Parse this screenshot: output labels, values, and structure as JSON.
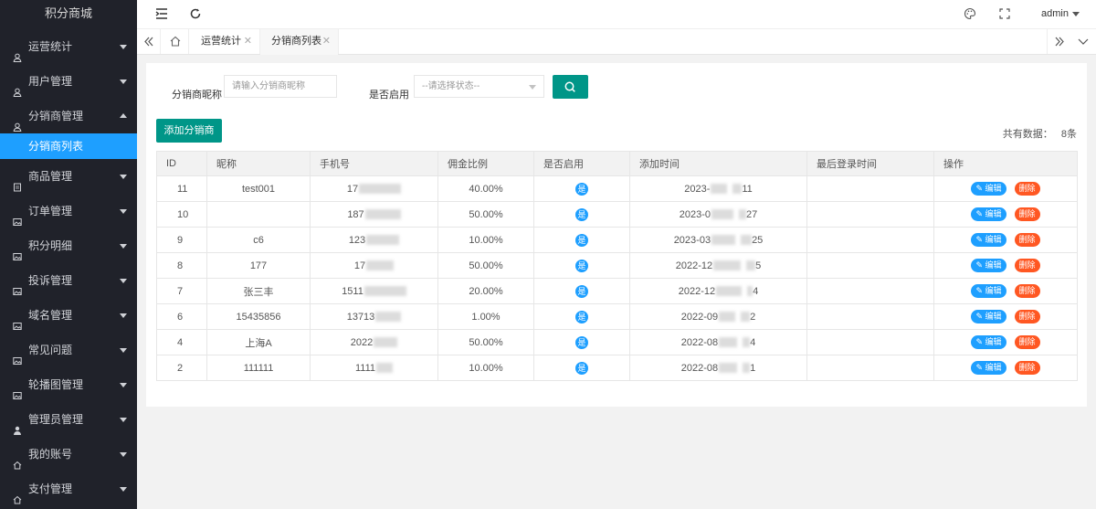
{
  "app": {
    "title": "积分商城"
  },
  "sidebar": {
    "items": [
      {
        "label": "运营统计",
        "icon": "user-icon"
      },
      {
        "label": "用户管理",
        "icon": "user-icon"
      },
      {
        "label": "分销商管理",
        "icon": "user-icon",
        "expanded": true
      },
      {
        "label": "商品管理",
        "icon": "document-icon"
      },
      {
        "label": "订单管理",
        "icon": "image-icon"
      },
      {
        "label": "积分明细",
        "icon": "image-icon"
      },
      {
        "label": "投诉管理",
        "icon": "image-icon"
      },
      {
        "label": "域名管理",
        "icon": "image-icon"
      },
      {
        "label": "常见问题",
        "icon": "image-icon"
      },
      {
        "label": "轮播图管理",
        "icon": "image-icon"
      },
      {
        "label": "管理员管理",
        "icon": "person-icon"
      },
      {
        "label": "我的账号",
        "icon": "home-icon"
      },
      {
        "label": "支付管理",
        "icon": "home-icon"
      }
    ],
    "sub_item": "分销商列表",
    "active_color": "#1e9fff"
  },
  "topbar": {
    "user": "admin"
  },
  "tabs": [
    {
      "label": "运营统计"
    },
    {
      "label": "分销商列表",
      "active": true
    }
  ],
  "search": {
    "nickname_label": "分销商昵称",
    "nickname_placeholder": "请输入分销商昵称",
    "status_label": "是否启用",
    "status_placeholder": "--请选择状态--"
  },
  "toolbar": {
    "add_label": "添加分销商",
    "total_label": "共有数据：",
    "total_value": "8条"
  },
  "table": {
    "columns": [
      "ID",
      "昵称",
      "手机号",
      "佣金比例",
      "是否启用",
      "添加时间",
      "最后登录时间",
      "操作"
    ],
    "rows": [
      {
        "id": "11",
        "nickname": "test001",
        "phone": "17",
        "ratio": "40.00%",
        "enabled": "是",
        "added": "2023-",
        "added_tail": "11",
        "last_login": ""
      },
      {
        "id": "10",
        "nickname": "",
        "phone": "187",
        "ratio": "50.00%",
        "enabled": "是",
        "added": "2023-0",
        "added_tail": "27",
        "last_login": ""
      },
      {
        "id": "9",
        "nickname": "c6",
        "phone": "123",
        "ratio": "10.00%",
        "enabled": "是",
        "added": "2023-03",
        "added_tail": "25",
        "last_login": ""
      },
      {
        "id": "8",
        "nickname": "177",
        "phone": "17",
        "ratio": "50.00%",
        "enabled": "是",
        "added": "2022-12",
        "added_tail": "5",
        "last_login": ""
      },
      {
        "id": "7",
        "nickname": "张三丰",
        "phone": "1511",
        "ratio": "20.00%",
        "enabled": "是",
        "added": "2022-12",
        "added_tail": "4",
        "last_login": ""
      },
      {
        "id": "6",
        "nickname": "15435856",
        "phone": "13713",
        "ratio": "1.00%",
        "enabled": "是",
        "added": "2022-09",
        "added_tail": "2",
        "last_login": ""
      },
      {
        "id": "4",
        "nickname": "上海A",
        "phone": "2022",
        "ratio": "50.00%",
        "enabled": "是",
        "added": "2022-08",
        "added_tail": "4",
        "last_login": ""
      },
      {
        "id": "2",
        "nickname": "111111",
        "phone": "1111",
        "ratio": "10.00%",
        "enabled": "是",
        "added": "2022-08",
        "added_tail": "1",
        "last_login": ""
      }
    ],
    "edit_label": "编辑",
    "delete_label": "删除"
  },
  "colors": {
    "primary": "#009688",
    "info": "#1e9fff",
    "danger": "#ff5722",
    "sidebar": "#20222a"
  }
}
